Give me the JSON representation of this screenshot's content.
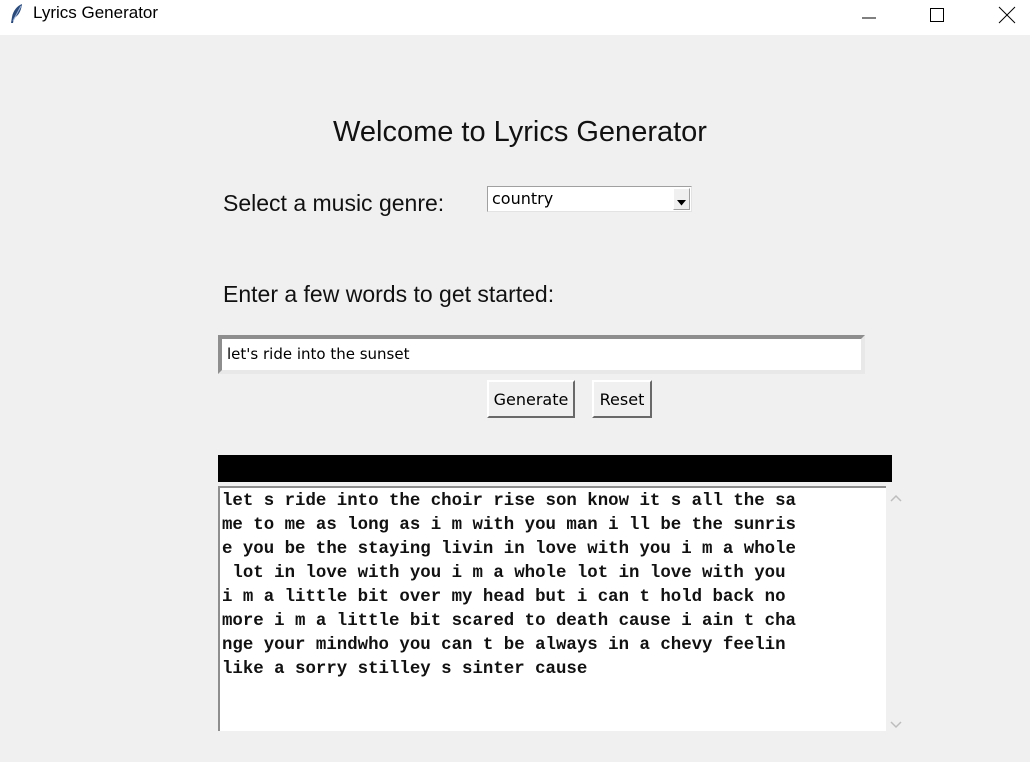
{
  "window": {
    "title": "Lyrics Generator",
    "icon": "feather-icon"
  },
  "main": {
    "heading": "Welcome to Lyrics Generator",
    "genre_label": "Select a music genre:",
    "genre_selected": "country",
    "prompt_label": "Enter a few words to get started:",
    "prompt_value": "let's ride into the sunset",
    "generate_label": "Generate",
    "reset_label": "Reset",
    "output_lines": [
      "let s ride into the choir rise son know it s all the sa",
      "me to me as long as i m with you man i ll be the sunris",
      "e you be the staying livin in love with you i m a whole",
      " lot in love with you i m a whole lot in love with you",
      "i m a little bit over my head but i can t hold back no",
      "more i m a little bit scared to death cause i ain t cha",
      "nge your mindwho you can t be always in a chevy feelin",
      "like a sorry stilley s sinter cause"
    ]
  }
}
